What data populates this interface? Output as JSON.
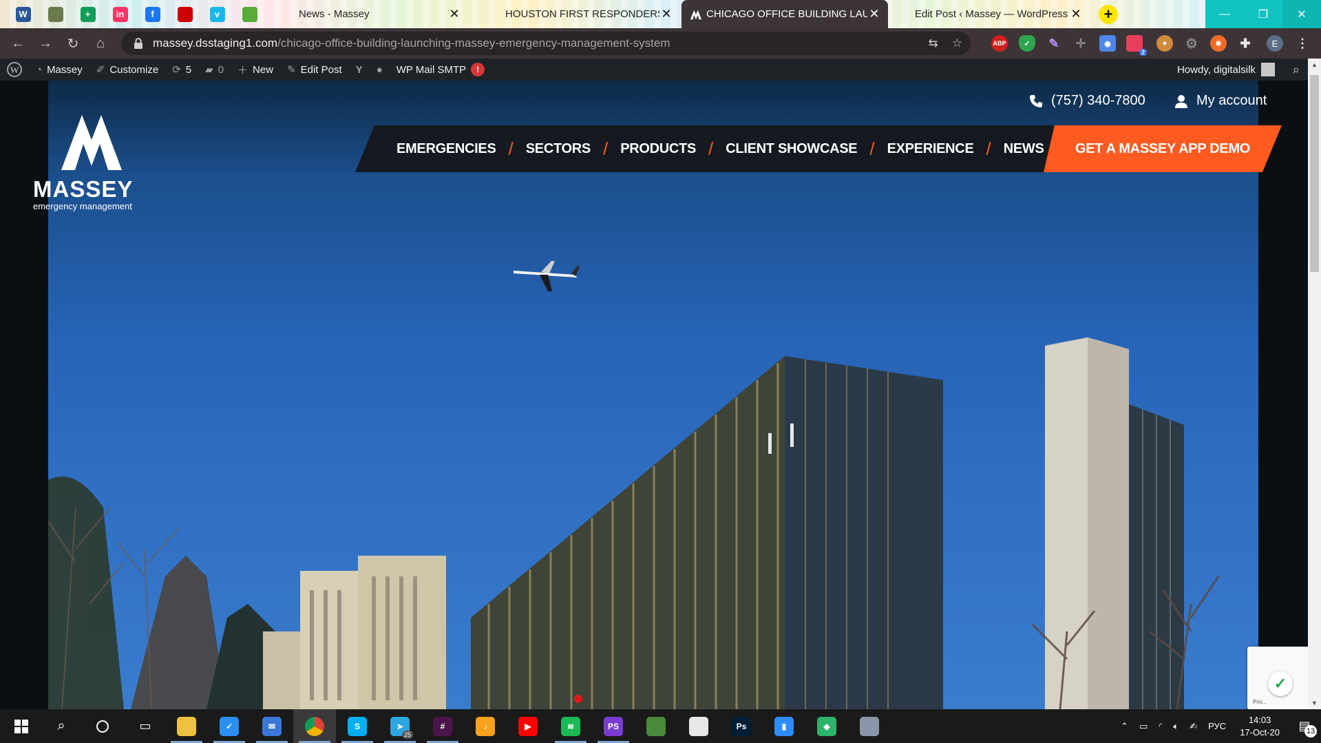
{
  "browser": {
    "pinned_tabs": [
      {
        "icon": "word-icon",
        "glyph": "W",
        "color": "#2b579a"
      },
      {
        "icon": "photo-app-icon",
        "glyph": "",
        "color": "#6a7a4a"
      },
      {
        "icon": "sheets-plus-icon",
        "glyph": "+",
        "color": "#0f9d58"
      },
      {
        "icon": "invision-icon",
        "glyph": "in",
        "color": "#ff3366"
      },
      {
        "icon": "facebook-icon",
        "glyph": "f",
        "color": "#1877f2"
      },
      {
        "icon": "red-hat-icon",
        "glyph": "",
        "color": "#cc0000"
      },
      {
        "icon": "vimeo-icon",
        "glyph": "v",
        "color": "#1ab7ea"
      },
      {
        "icon": "green-app-icon",
        "glyph": "",
        "color": "#5aaa3c"
      }
    ],
    "tabs": [
      {
        "title": "News - Massey",
        "active": false
      },
      {
        "title": "HOUSTON FIRST RESPONDERS D",
        "active": false
      },
      {
        "title": "CHICAGO OFFICE BUILDING LAU",
        "active": true
      },
      {
        "title": "Edit Post ‹ Massey — WordPress",
        "active": false
      }
    ],
    "new_tab_label": "+",
    "url_host": "massey.dsstaging1.com",
    "url_path": "/chicago-office-building-launching-massey-emergency-management-system",
    "profile_initial": "E",
    "ext_badge": "2",
    "adblock_label": "ABP"
  },
  "wp_admin_bar": {
    "site_name": "Massey",
    "customize": "Customize",
    "updates_count": "5",
    "comments_count": "0",
    "new_label": "New",
    "edit_post": "Edit Post",
    "wp_mail_smtp": "WP Mail SMTP",
    "smtp_alert": "!",
    "howdy": "Howdy, digitalsilk"
  },
  "site": {
    "logo_word": "MASSEY",
    "logo_sub": "emergency management",
    "phone": "(757) 340-7800",
    "account": "My account",
    "nav": [
      "EMERGENCIES",
      "SECTORS",
      "PRODUCTS",
      "CLIENT SHOWCASE",
      "EXPERIENCE",
      "NEWS"
    ],
    "cta": "GET A MASSEY APP DEMO",
    "accent_color": "#ff5a1f",
    "recaptcha_label": "Priv..."
  },
  "taskbar": {
    "apps": [
      {
        "name": "file-explorer-icon",
        "color": "#f0c040",
        "glyph": "",
        "running": true
      },
      {
        "name": "todo-icon",
        "color": "#2a8ff0",
        "glyph": "✓",
        "running": true
      },
      {
        "name": "mail-icon",
        "color": "#3a78d8",
        "glyph": "✉",
        "running": true
      },
      {
        "name": "chrome-icon",
        "color": "#db4437",
        "glyph": "",
        "running": true,
        "active": true
      },
      {
        "name": "skype-icon",
        "color": "#00aff0",
        "glyph": "S",
        "running": true
      },
      {
        "name": "telegram-icon",
        "color": "#2ca5e0",
        "glyph": "➤",
        "running": true,
        "badge": "25"
      },
      {
        "name": "slack-icon",
        "color": "#4a154b",
        "glyph": "#",
        "running": true
      },
      {
        "name": "music-icon",
        "color": "#f7a21b",
        "glyph": "♪",
        "running": false
      },
      {
        "name": "youtube-icon",
        "color": "#ff0000",
        "glyph": "▶",
        "running": false
      },
      {
        "name": "spotify-icon",
        "color": "#1db954",
        "glyph": "≋",
        "running": true
      },
      {
        "name": "phpstorm-icon",
        "color": "#7a3cd0",
        "glyph": "PS",
        "running": true
      },
      {
        "name": "image-viewer-icon",
        "color": "#4a8a3a",
        "glyph": "",
        "running": false
      },
      {
        "name": "notepad-icon",
        "color": "#e8e8e8",
        "glyph": "",
        "running": false
      },
      {
        "name": "photoshop-icon",
        "color": "#001e36",
        "glyph": "Ps",
        "running": false
      },
      {
        "name": "zoom-icon",
        "color": "#2d8cff",
        "glyph": "▮",
        "running": false
      },
      {
        "name": "vpn-icon",
        "color": "#2db36b",
        "glyph": "◆",
        "running": false
      },
      {
        "name": "display-icon",
        "color": "#8a97a8",
        "glyph": "",
        "running": false
      }
    ],
    "lang": "РУС",
    "time": "14:03",
    "date": "17-Oct-20",
    "notif_count": "13"
  }
}
